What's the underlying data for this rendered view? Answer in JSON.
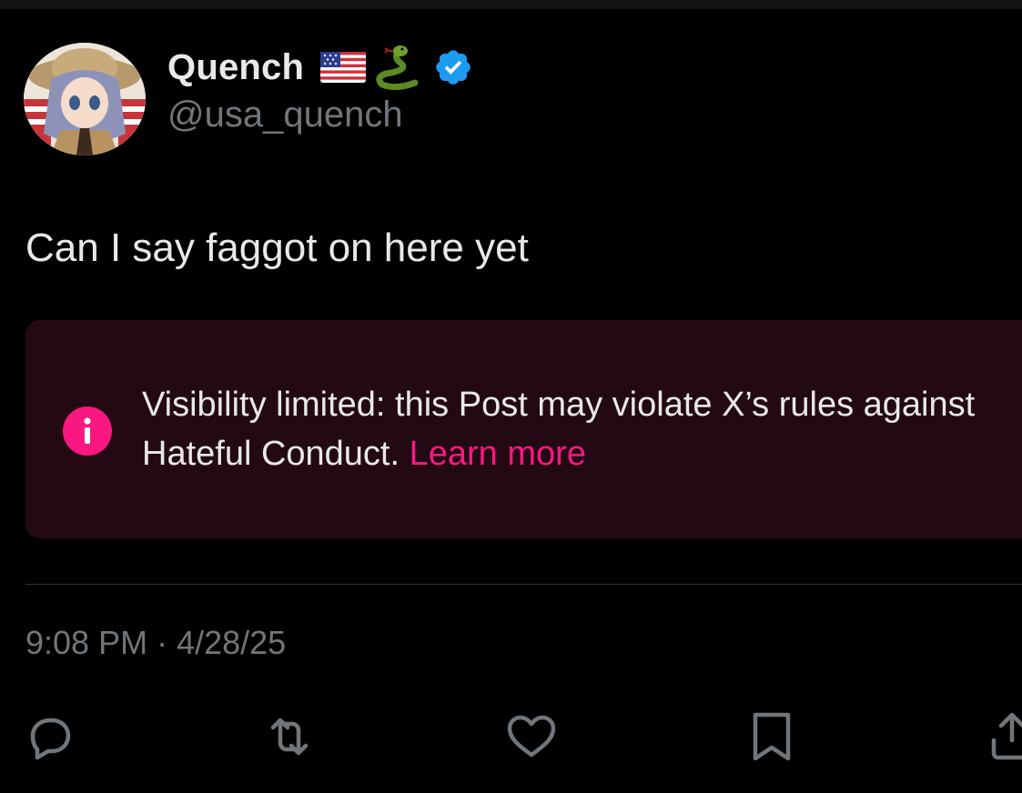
{
  "author": {
    "display_name": "Quench",
    "handle": "@usa_quench",
    "badges": [
      "flag-us-icon",
      "snake-icon",
      "verified-icon"
    ]
  },
  "post": {
    "text": "Can I say faggot on here yet"
  },
  "notice": {
    "message": "Visibility limited: this Post may violate X’s rules against Hateful Conduct.",
    "link_label": "Learn more"
  },
  "meta": {
    "timestamp": "9:08 PM · 4/28/25"
  },
  "actions": [
    "reply-icon",
    "repost-icon",
    "like-icon",
    "bookmark-icon",
    "share-icon"
  ],
  "colors": {
    "background": "#000000",
    "text_primary": "#e7e9ea",
    "text_secondary": "#71767b",
    "notice_background": "#230913",
    "accent_pink": "#f91880",
    "verified_blue": "#1d9bf0"
  }
}
